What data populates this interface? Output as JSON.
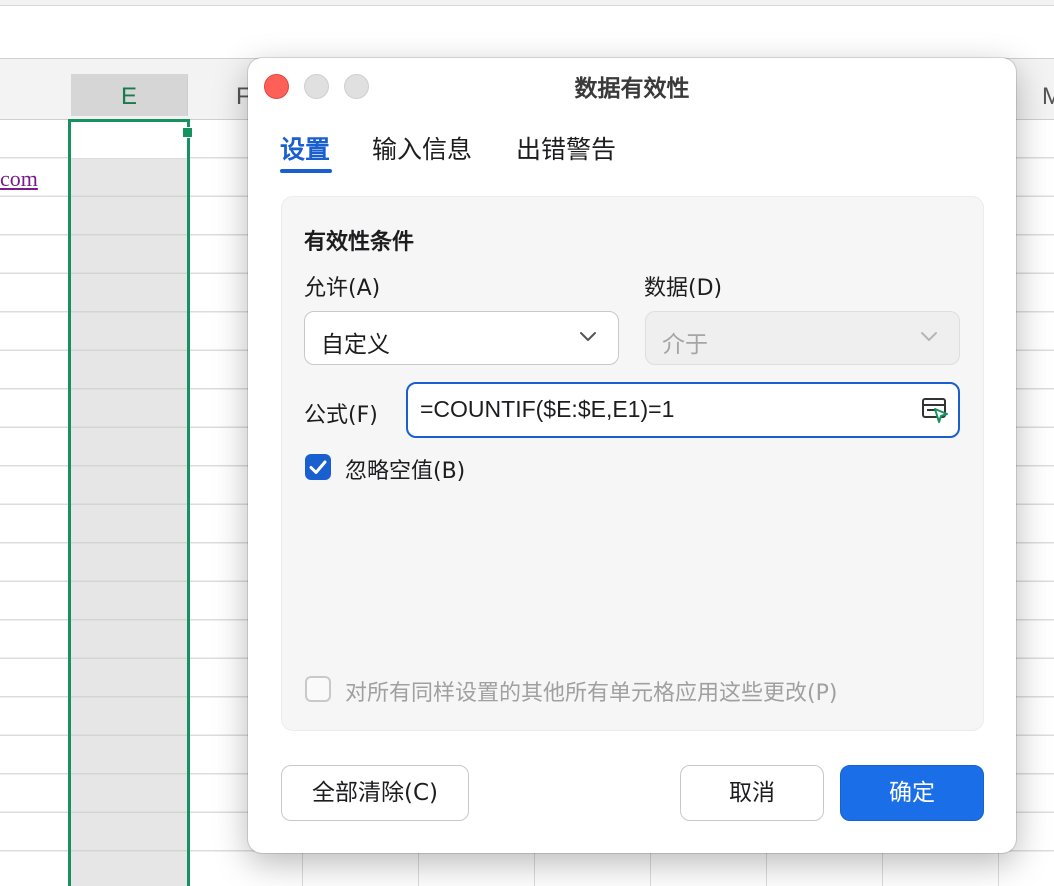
{
  "spreadsheet": {
    "columns": {
      "e": "E",
      "f": "F",
      "m": "M"
    },
    "cell_link_fragment": "com"
  },
  "dialog": {
    "title": "数据有效性",
    "tabs": [
      {
        "label": "设置",
        "active": true
      },
      {
        "label": "输入信息",
        "active": false
      },
      {
        "label": "出错警告",
        "active": false
      }
    ],
    "section_title": "有效性条件",
    "allow": {
      "label": "允许(A)",
      "value": "自定义"
    },
    "data": {
      "label": "数据(D)",
      "value": "介于",
      "disabled": true
    },
    "formula": {
      "label": "公式(F)",
      "value": "=COUNTIF($E:$E,E1)=1"
    },
    "ignore_blank": {
      "label": "忽略空值(B)",
      "checked": true
    },
    "apply_all": {
      "label": "对所有同样设置的其他所有单元格应用这些更改(P)",
      "checked": false
    },
    "buttons": {
      "clear_all": "全部清除(C)",
      "cancel": "取消",
      "ok": "确定"
    }
  },
  "colors": {
    "accent": "#1a5fd0",
    "primary_button": "#1a6ee8",
    "selection": "#169160",
    "close_button": "#fe5f57",
    "link": "#7a1b8c"
  },
  "icons": [
    "chevron-down-icon",
    "cell-picker-icon",
    "checkmark-icon"
  ]
}
